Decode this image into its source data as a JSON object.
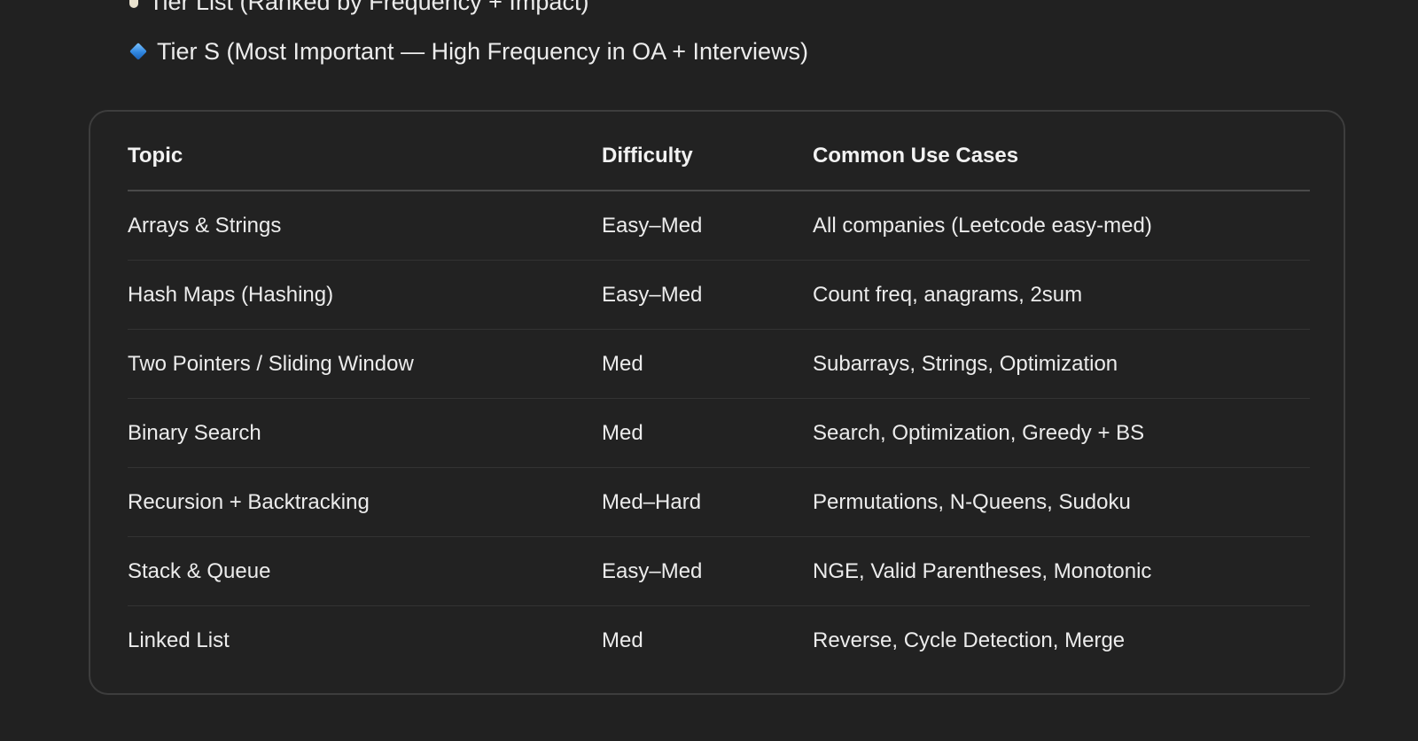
{
  "headings": {
    "partial": "Tier List (Ranked by Frequency + Impact)",
    "section": "Tier S (Most Important — High Frequency in OA + Interviews)",
    "section_icon": "blue-diamond-icon"
  },
  "table": {
    "columns": [
      "Topic",
      "Difficulty",
      "Common Use Cases"
    ],
    "rows": [
      [
        "Arrays & Strings",
        "Easy–Med",
        "All companies (Leetcode easy-med)"
      ],
      [
        "Hash Maps (Hashing)",
        "Easy–Med",
        "Count freq, anagrams, 2sum"
      ],
      [
        "Two Pointers / Sliding Window",
        "Med",
        "Subarrays, Strings, Optimization"
      ],
      [
        "Binary Search",
        "Med",
        "Search, Optimization, Greedy + BS"
      ],
      [
        "Recursion + Backtracking",
        "Med–Hard",
        "Permutations, N-Queens, Sudoku"
      ],
      [
        "Stack & Queue",
        "Easy–Med",
        "NGE, Valid Parentheses, Monotonic"
      ],
      [
        "Linked List",
        "Med",
        "Reverse, Cycle Detection, Merge"
      ]
    ]
  },
  "colors": {
    "background": "#212121",
    "text": "#ececec",
    "card_border": "#3d3d3d"
  }
}
